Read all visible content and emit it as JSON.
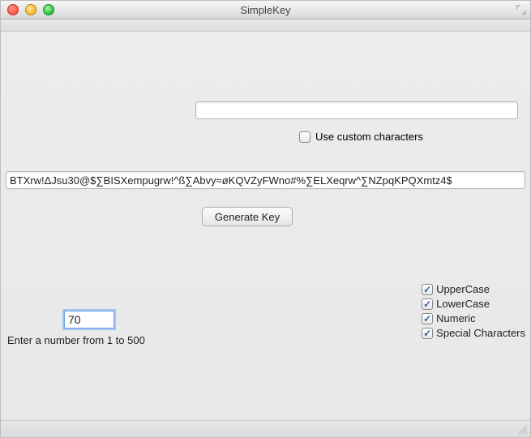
{
  "window": {
    "title": "SimpleKey"
  },
  "custom": {
    "value": "",
    "checkbox_checked": false,
    "label": "Use custom characters"
  },
  "generated": {
    "value": "BTXrw!ΔJsu30@$∑BISXempugrw!^ß∑Abvy≈øKQVZyFWno#%∑ELXeqrw^∑NZpqKPQXmtz4$"
  },
  "actions": {
    "generate": "Generate Key"
  },
  "options": {
    "uppercase": {
      "label": "UpperCase",
      "checked": true
    },
    "lowercase": {
      "label": "LowerCase",
      "checked": true
    },
    "numeric": {
      "label": "Numeric",
      "checked": true
    },
    "special": {
      "label": "Special Characters",
      "checked": true
    }
  },
  "length": {
    "value": "70",
    "hint": "Enter a number from 1 to 500"
  }
}
